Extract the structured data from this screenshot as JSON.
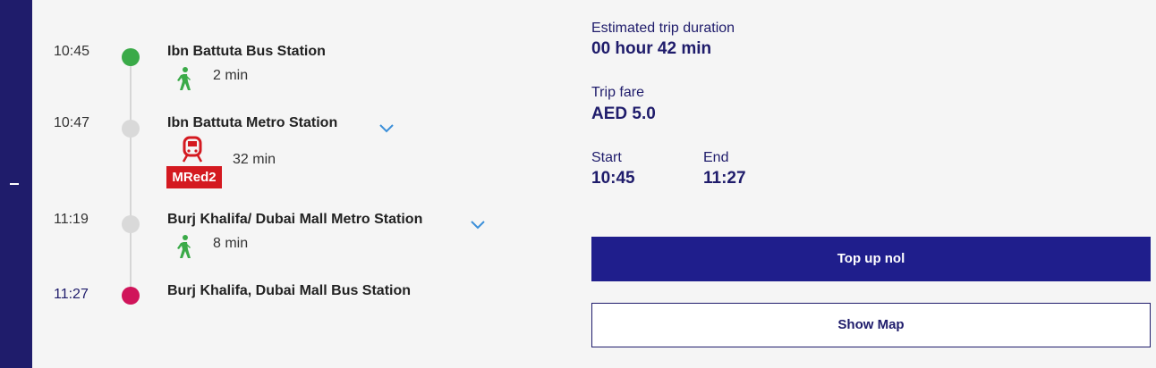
{
  "itinerary": {
    "stops": [
      {
        "time": "10:45",
        "name": "Ibn Battuta Bus Station"
      },
      {
        "time": "10:47",
        "name": "Ibn Battuta Metro Station"
      },
      {
        "time": "11:19",
        "name": "Burj Khalifa/ Dubai Mall Metro Station"
      },
      {
        "time": "11:27",
        "name": "Burj Khalifa, Dubai Mall Bus Station"
      }
    ],
    "legs": [
      {
        "mode": "walk",
        "icon": "walking-person-icon",
        "duration": "2 min"
      },
      {
        "mode": "metro",
        "icon": "metro-train-icon",
        "line": "MRed2",
        "duration": "32 min"
      },
      {
        "mode": "walk",
        "icon": "walking-person-icon",
        "duration": "8 min"
      }
    ]
  },
  "summary": {
    "duration_label": "Estimated trip duration",
    "duration_value": "00 hour 42 min",
    "fare_label": "Trip fare",
    "fare_value": "AED 5.0",
    "start_label": "Start",
    "start_value": "10:45",
    "end_label": "End",
    "end_value": "11:27"
  },
  "actions": {
    "topup_label": "Top up nol",
    "map_label": "Show Map"
  },
  "colors": {
    "brand_navy": "#1f1c6b",
    "start_dot": "#3aaa48",
    "end_dot": "#d0145a",
    "metro_red": "#d41920",
    "walk_green": "#3aaa48",
    "chevron_blue": "#3b8fd9"
  }
}
